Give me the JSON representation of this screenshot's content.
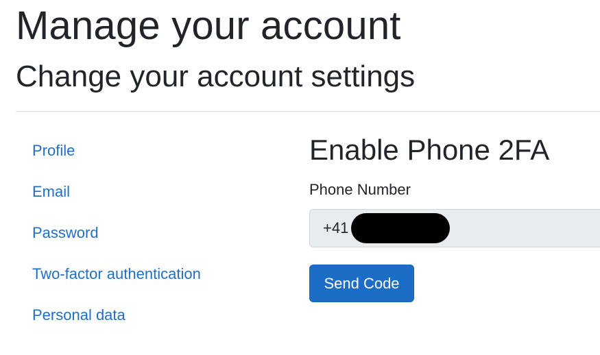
{
  "header": {
    "title": "Manage your account",
    "subtitle": "Change your account settings"
  },
  "sidebar": {
    "items": [
      {
        "label": "Profile"
      },
      {
        "label": "Email"
      },
      {
        "label": "Password"
      },
      {
        "label": "Two-factor authentication"
      },
      {
        "label": "Personal data"
      }
    ]
  },
  "main": {
    "heading": "Enable Phone 2FA",
    "phone": {
      "label": "Phone Number",
      "prefix": "+41",
      "value_redacted": true
    },
    "send_button_label": "Send Code"
  },
  "colors": {
    "link": "#1f6fc5",
    "primary_button": "#1c6dc6",
    "input_background": "#e9ecef"
  }
}
